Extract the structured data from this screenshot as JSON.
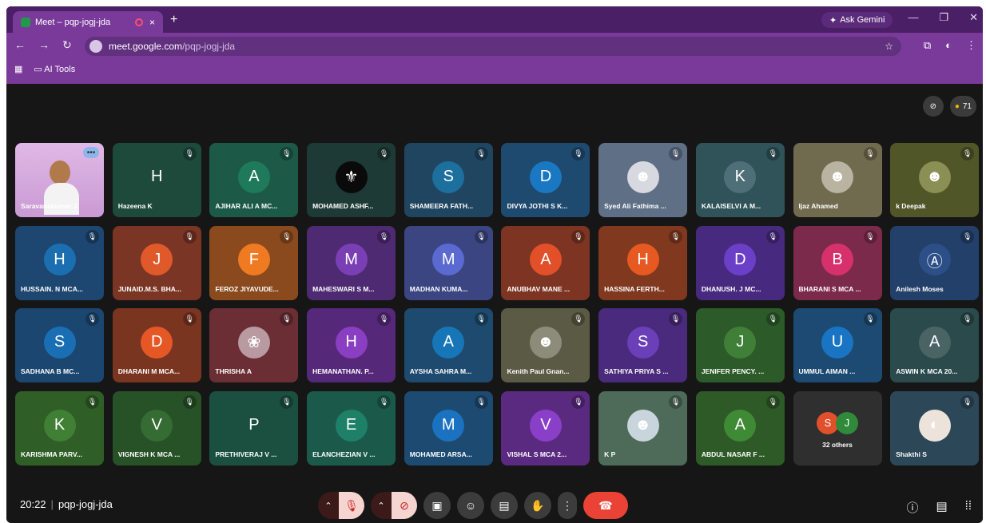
{
  "browser": {
    "tab_title": "Meet – pqp-jogj-jda",
    "tab_close": "×",
    "new_tab": "+",
    "ask_gemini": "Ask Gemini",
    "url_host": "meet.google.com",
    "url_path": "/pqp-jogj-jda",
    "bookmark_folder": "AI Tools"
  },
  "meet": {
    "participant_count": "71",
    "time": "20:22",
    "meeting_code": "pqp-jogj-jda",
    "others_label": "32 others",
    "tiles": [
      {
        "name": "Saravanakumar J",
        "initial": "",
        "bg": "#d7a7de",
        "ava": "",
        "video": true
      },
      {
        "name": "Hazeena K",
        "initial": "H",
        "bg": "#1e4a3c",
        "ava": "#1e4a3c"
      },
      {
        "name": "AJIHAR ALI A MC...",
        "initial": "A",
        "bg": "#1c5a47",
        "ava": "#1f7a5c"
      },
      {
        "name": "MOHAMED ASHF...",
        "initial": "⚜",
        "bg": "#1e3a36",
        "ava": "#0a0a0a"
      },
      {
        "name": "SHAMEERA FATH...",
        "initial": "S",
        "bg": "#1f4560",
        "ava": "#1d6f9d"
      },
      {
        "name": "DIVYA JOTHI S K...",
        "initial": "D",
        "bg": "#1f4a70",
        "ava": "#1a78c2"
      },
      {
        "name": "Syed Ali Fathima ...",
        "initial": "☻",
        "bg": "#5e6f86",
        "ava": "#d8d8e0"
      },
      {
        "name": "KALAISELVI A M...",
        "initial": "K",
        "bg": "#2f5358",
        "ava": "#4f6f78"
      },
      {
        "name": "Ijaz Ahamed",
        "initial": "☻",
        "bg": "#706b4e",
        "ava": "#b9b3a2"
      },
      {
        "name": "k Deepak",
        "initial": "☻",
        "bg": "#505628",
        "ava": "#8a8f55"
      },
      {
        "name": "HUSSAIN. N MCA...",
        "initial": "H",
        "bg": "#1d4670",
        "ava": "#1b6fb0"
      },
      {
        "name": "JUNAID.M.S. BHA...",
        "initial": "J",
        "bg": "#7a3524",
        "ava": "#e0592a"
      },
      {
        "name": "FEROZ JIYAVUDE...",
        "initial": "F",
        "bg": "#8a4a1e",
        "ava": "#f07a22"
      },
      {
        "name": "MAHESWARI S M...",
        "initial": "M",
        "bg": "#4d2a72",
        "ava": "#7a3fb5"
      },
      {
        "name": "MADHAN KUMA...",
        "initial": "M",
        "bg": "#3a4582",
        "ava": "#5a6ad0"
      },
      {
        "name": "ANUBHAV MANE ...",
        "initial": "A",
        "bg": "#7d3422",
        "ava": "#e2502a"
      },
      {
        "name": "HASSINA FERTH...",
        "initial": "H",
        "bg": "#80381f",
        "ava": "#e65a22"
      },
      {
        "name": "DHANUSH. J MC...",
        "initial": "D",
        "bg": "#472a80",
        "ava": "#6c3fc9"
      },
      {
        "name": "BHARANI S MCA ...",
        "initial": "B",
        "bg": "#7c2a4c",
        "ava": "#d6316a"
      },
      {
        "name": "Anilesh Moses",
        "initial": "Ⓐ",
        "bg": "#23406a",
        "ava": "#2d4f87"
      },
      {
        "name": "SADHANA B MC...",
        "initial": "S",
        "bg": "#1b4670",
        "ava": "#1a6fb4"
      },
      {
        "name": "DHARANI M MCA...",
        "initial": "D",
        "bg": "#7a3521",
        "ava": "#e65726"
      },
      {
        "name": "THRISHA A",
        "initial": "❀",
        "bg": "#6a2e34",
        "ava": "#b89aa0"
      },
      {
        "name": "HEMANATHAN. P...",
        "initial": "H",
        "bg": "#55287a",
        "ava": "#8a3fc2"
      },
      {
        "name": "AYSHA SAHRA M...",
        "initial": "A",
        "bg": "#1d4a6e",
        "ava": "#1776b8"
      },
      {
        "name": "Kenith Paul Gnan...",
        "initial": "☻",
        "bg": "#5b5a45",
        "ava": "#8d8c7a"
      },
      {
        "name": "SATHIYA PRIYA S ...",
        "initial": "S",
        "bg": "#4a2a7c",
        "ava": "#6a3fb8"
      },
      {
        "name": "JENIFER PENCY. ...",
        "initial": "J",
        "bg": "#2c5a28",
        "ava": "#3f7f38"
      },
      {
        "name": "UMMUL AIMAN ...",
        "initial": "U",
        "bg": "#1d4a72",
        "ava": "#1a74c4"
      },
      {
        "name": "ASWIN K MCA 20...",
        "initial": "A",
        "bg": "#2a4a4c",
        "ava": "#4a6466"
      },
      {
        "name": "KARISHMA PARV...",
        "initial": "K",
        "bg": "#2f5e26",
        "ava": "#3f8034"
      },
      {
        "name": "VIGNESH K MCA ...",
        "initial": "V",
        "bg": "#275126",
        "ava": "#356c33"
      },
      {
        "name": "PRETHIVERAJ V ...",
        "initial": "P",
        "bg": "#1b5040",
        "ava": "#1b5040"
      },
      {
        "name": "ELANCHEZIAN V ...",
        "initial": "E",
        "bg": "#1b5a4a",
        "ava": "#1f8068"
      },
      {
        "name": "MOHAMED ARSA...",
        "initial": "M",
        "bg": "#1d4a70",
        "ava": "#1a72c0"
      },
      {
        "name": "VISHAL S MCA 2...",
        "initial": "V",
        "bg": "#5a2a80",
        "ava": "#8a3fc8"
      },
      {
        "name": "K P",
        "initial": "☻",
        "bg": "#4e6a58",
        "ava": "#c9d5dc"
      },
      {
        "name": "ABDUL NASAR F ...",
        "initial": "A",
        "bg": "#2e5a28",
        "ava": "#3f8a34"
      },
      {
        "name": "32 others",
        "initial": "",
        "bg": "#2f2f2f",
        "ava": "",
        "others": true
      },
      {
        "name": "Shakthi S",
        "initial": "◐",
        "bg": "#2c4858",
        "ava": "#ece4da"
      }
    ]
  },
  "colors": {
    "chrome": "#7a3a9a",
    "hangup": "#ea4335",
    "muted_chip": "#f6d4d0"
  }
}
